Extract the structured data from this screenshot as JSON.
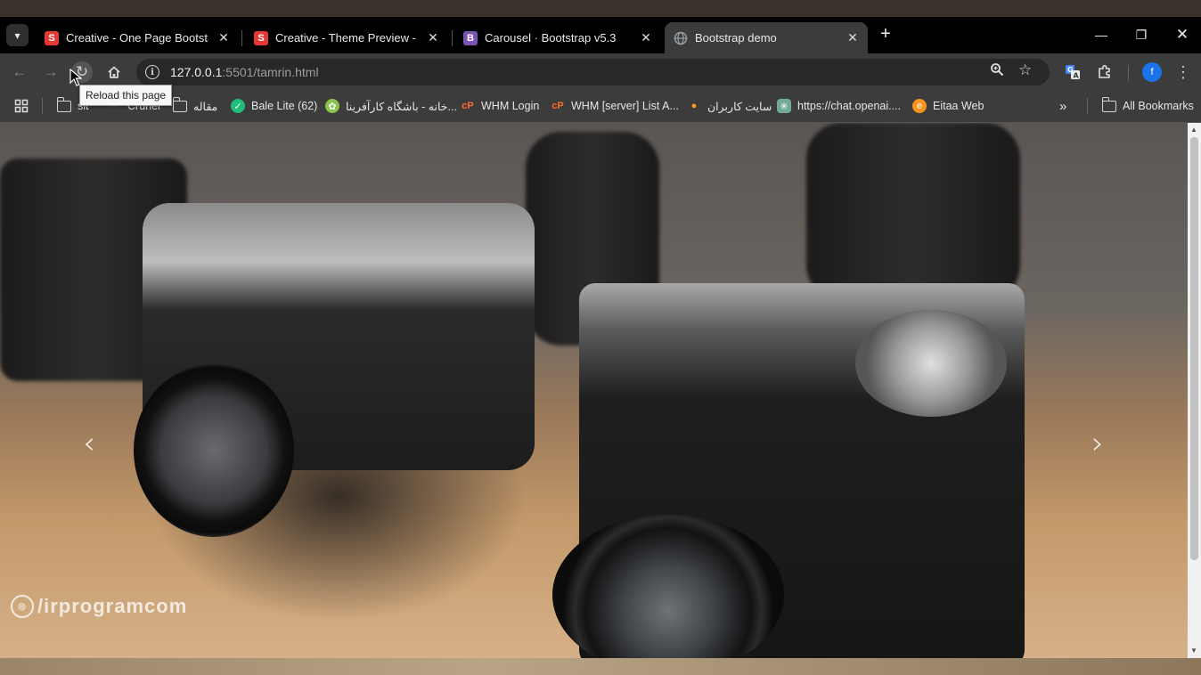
{
  "browser": {
    "tabs": [
      {
        "title": "Creative - One Page Bootstrap",
        "favicon": "S",
        "favicon_color": "#e53935"
      },
      {
        "title": "Creative - Theme Preview - Star",
        "favicon": "S",
        "favicon_color": "#e53935"
      },
      {
        "title": "Carousel · Bootstrap v5.3",
        "favicon": "B",
        "favicon_color": "#7952b3"
      },
      {
        "title": "Bootstrap demo",
        "favicon": "globe-icon",
        "favicon_color": "#9aa0a6",
        "active": true
      }
    ],
    "address": {
      "host": "127.0.0.1",
      "path": ":5501/tamrin.html"
    },
    "tooltip": "Reload this page",
    "profile_initial": "f",
    "accent_color": "#1a73e8"
  },
  "bookmarks": {
    "items": [
      {
        "label": "sit",
        "icon": "folder-icon"
      },
      {
        "label": "Cruner",
        "icon": "wave-icon"
      },
      {
        "label": "مقاله",
        "icon": "folder-icon"
      },
      {
        "label": "Bale Lite (62)",
        "icon": "bale-icon"
      },
      {
        "label": "خانه - باشگاه کارآفرینا...",
        "icon": "leaf-icon"
      },
      {
        "label": "WHM Login",
        "icon": "cpanel-icon"
      },
      {
        "label": "WHM [server] List A...",
        "icon": "cpanel-icon"
      },
      {
        "label": "سایت کاربران",
        "icon": "fruit-icon"
      },
      {
        "label": "https://chat.openai....",
        "icon": "openai-icon"
      },
      {
        "label": "Eitaa Web",
        "icon": "eitaa-icon"
      }
    ],
    "all_bookmarks": "All Bookmarks"
  },
  "page": {
    "watermark": "/irprogramcom",
    "carousel_prev": "‹",
    "carousel_next": "›"
  }
}
